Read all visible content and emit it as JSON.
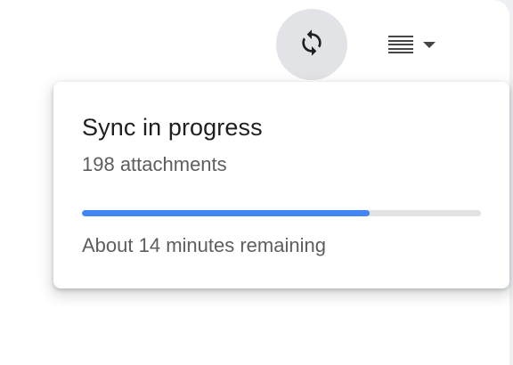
{
  "toolbar": {
    "sync_icon": "sync-icon",
    "density_icon": "density-lines-icon",
    "caret_icon": "caret-down-icon"
  },
  "sync_popover": {
    "title": "Sync in progress",
    "subtitle": "198 attachments",
    "progress_fraction": 0.72,
    "eta_text": "About 14 minutes remaining"
  },
  "colors": {
    "progress_fill": "#4285f4",
    "progress_track": "#e3e3e6",
    "sync_button_bg": "#e2e3e6"
  }
}
